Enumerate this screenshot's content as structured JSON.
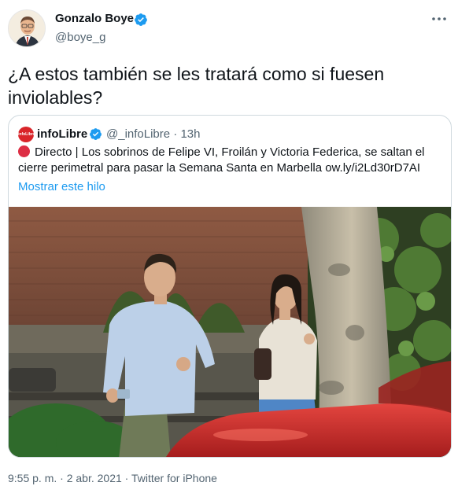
{
  "tweet": {
    "author": {
      "display_name": "Gonzalo Boye",
      "handle": "@boye_g",
      "verified": true,
      "avatar_icon": "avatar-illustration"
    },
    "text": "¿A estos también se les tratará como si fuesen inviolables?",
    "quoted": {
      "avatar_label": "infoLibre",
      "name": "infoLibre",
      "verified": true,
      "handle": "@_infoLibre",
      "separator": "·",
      "time": "13h",
      "text": "Directo | Los sobrinos de Felipe VI, Froilán y Victoria Federica, se saltan el cierre perimetral para pasar la Semana Santa en Marbella ow.ly/i2Ld30rD7AI",
      "show_thread": "Mostrar este hilo",
      "live_icon": "red-circle-icon"
    },
    "meta": {
      "time": "9:55 p. m.",
      "dot1": "·",
      "date": "2 abr. 2021",
      "dot2": "·",
      "source": "Twitter for iPhone"
    }
  },
  "colors": {
    "accent": "#1d9bf0",
    "text": "#0f1419",
    "secondary": "#536471",
    "border": "#cfd9de",
    "brand_red": "#d9252a"
  }
}
